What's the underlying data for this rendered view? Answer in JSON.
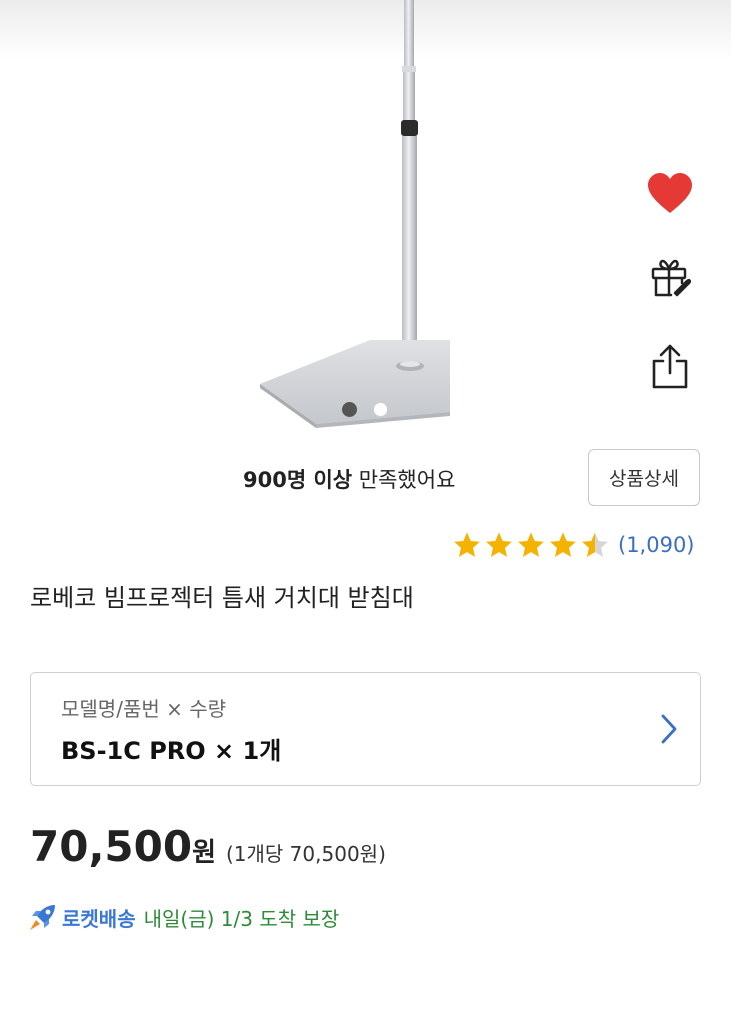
{
  "image_carousel": {
    "total": 2,
    "current": 1
  },
  "side_actions": {
    "wishlist_icon": "heart-icon",
    "gift_icon": "gift-icon",
    "share_icon": "share-icon",
    "wishlist_color": "#e53935"
  },
  "satisfaction": {
    "count_text": "900명 이상",
    "suffix": " 만족했어요"
  },
  "detail_button_label": "상품상세",
  "rating": {
    "stars": 4.5,
    "max": 5,
    "count_text": "(1,090)",
    "star_color": "#f5b301"
  },
  "product_title": "로베코 빔프로젝터 틈새 거치대 받침대",
  "option": {
    "label": "모델명/품번 × 수량",
    "value": "BS-1C PRO × 1개"
  },
  "price": {
    "amount": "70,500",
    "unit": "원",
    "unit_price": "(1개당 70,500원)"
  },
  "delivery": {
    "rocket_label": "로켓배송",
    "text": "내일(금) 1/3 도착 보장",
    "rocket_color": "#3a78d4",
    "text_color": "#2e8b3a"
  }
}
